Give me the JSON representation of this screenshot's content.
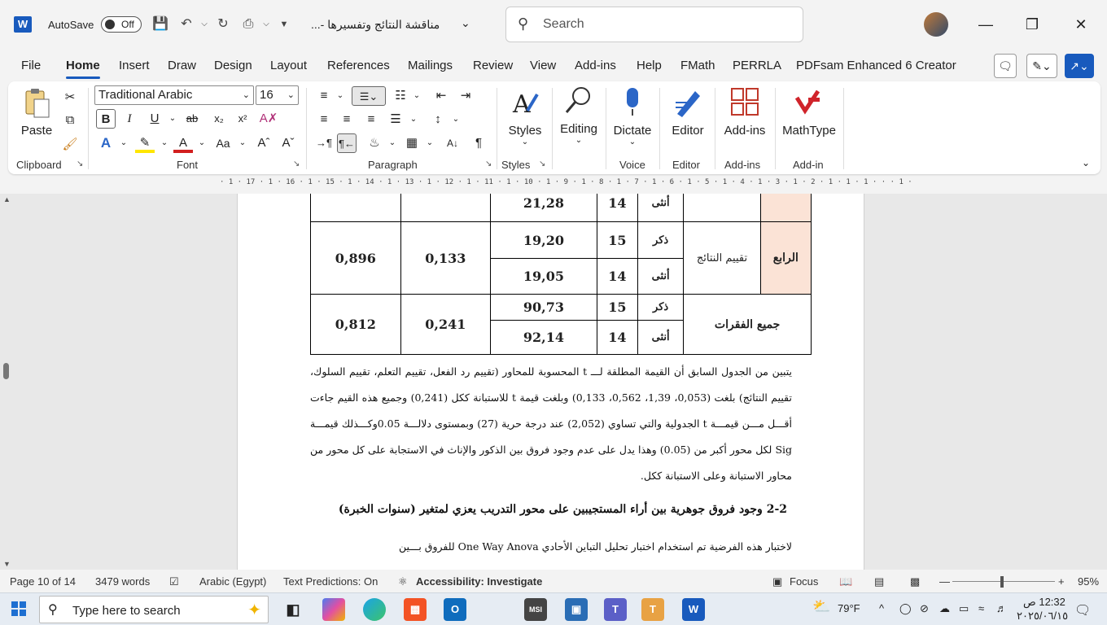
{
  "titlebar": {
    "autosave_label": "AutoSave",
    "autosave_state": "Off",
    "doc_title": "مناقشة النتائج وتفسيرها -...",
    "search_placeholder": "Search"
  },
  "tabs": [
    "File",
    "Home",
    "Insert",
    "Draw",
    "Design",
    "Layout",
    "References",
    "Mailings",
    "Review",
    "View",
    "Add-ins",
    "Help",
    "FMath",
    "PERRLA",
    "PDFsam Enhanced 6 Creator"
  ],
  "active_tab": "Home",
  "ribbon": {
    "clipboard": {
      "paste": "Paste",
      "label": "Clipboard"
    },
    "font": {
      "name": "Traditional Arabic",
      "size": "16",
      "label": "Font"
    },
    "paragraph": {
      "label": "Paragraph"
    },
    "styles": {
      "button": "Styles",
      "label": "Styles"
    },
    "editing": {
      "button": "Editing"
    },
    "voice": {
      "button": "Dictate",
      "label": "Voice"
    },
    "editor": {
      "button": "Editor",
      "label": "Editor"
    },
    "addins": {
      "button": "Add-ins",
      "label": "Add-ins"
    },
    "mathtype": {
      "button": "MathType",
      "label": "Add-in"
    }
  },
  "ruler": {
    "text": "· 1 · 17 · 1 · 16 · 1 · 15 · 1 · 14 · 1 · 13 · 1 · 12 · 1 · 11 · 1 · 10 · 1 · 9 · 1 · 8 · 1 · 7 · 1 · 6 · 1 · 5 · 1 · 4 · 1 · 3 · 1 · 2 · 1 · 1 · 1 · · · 1 ·"
  },
  "table": {
    "row0": {
      "gender": "أنثى",
      "n": "14",
      "mean": "21,28"
    },
    "row_fourth": {
      "axis": "الرابع",
      "item": "تقييم النتائج",
      "t": "0,133",
      "sig": "0,896",
      "male": {
        "gender": "ذكر",
        "n": "15",
        "mean": "19,20"
      },
      "female": {
        "gender": "أنثى",
        "n": "14",
        "mean": "19,05"
      }
    },
    "row_all": {
      "axis": "جميع الفقرات",
      "t": "0,241",
      "sig": "0,812",
      "male": {
        "gender": "ذكر",
        "n": "15",
        "mean": "90,73"
      },
      "female": {
        "gender": "أنثى",
        "n": "14",
        "mean": "92,14"
      }
    }
  },
  "body": {
    "paragraph1": "يتبين من الجدول السابق أن القيمة المطلقة لـــ t المحسوبة للمحاور (تقييم رد الفعل، تقييم التعلم، تقييم السلوك، تقييم النتائج) بلغت (0,053، 1,39، 0,562، 0,133) وبلغت قيمة t للاستبانة ككل (0,241) وجميع هذه القيم جاءت أقـــل مـــن قيمـــة t الجدولية والتي تساوي (2,052) عند درجة حرية (27) وبمستوى دلالـــة 0.05وكـــذلك قيمـــة Sig لكل محور أكبر من (0.05) وهذا يدل على عدم وجود فروق بين الذكور والإناث في الاستجابة على كل محور من محاور الاستبانة وعلى الاستبانة ككل.",
    "heading": "2-2 وجود فروق جوهرية بين أراء المستجيبين على محور التدريب يعزي لمتغير (سنوات الخبرة)",
    "paragraph2": "لاختبار هذه الفرضية تم استخدام اختبار تحليل التباين الأحادي One Way Anova للفروق بـــين"
  },
  "statusbar": {
    "page": "Page 10 of 14",
    "words": "3479 words",
    "language": "Arabic (Egypt)",
    "predictions": "Text Predictions: On",
    "accessibility": "Accessibility: Investigate",
    "focus": "Focus",
    "zoom": "95%"
  },
  "taskbar": {
    "search_placeholder": "Type here to search",
    "temperature": "79°F",
    "time": "12:32 ص",
    "date": "٢٠٢٥/٠٦/١٥"
  },
  "colors": {
    "accent": "#185abd",
    "axis_cell": "#fbe3d6",
    "mathtype": "#d0242b"
  }
}
